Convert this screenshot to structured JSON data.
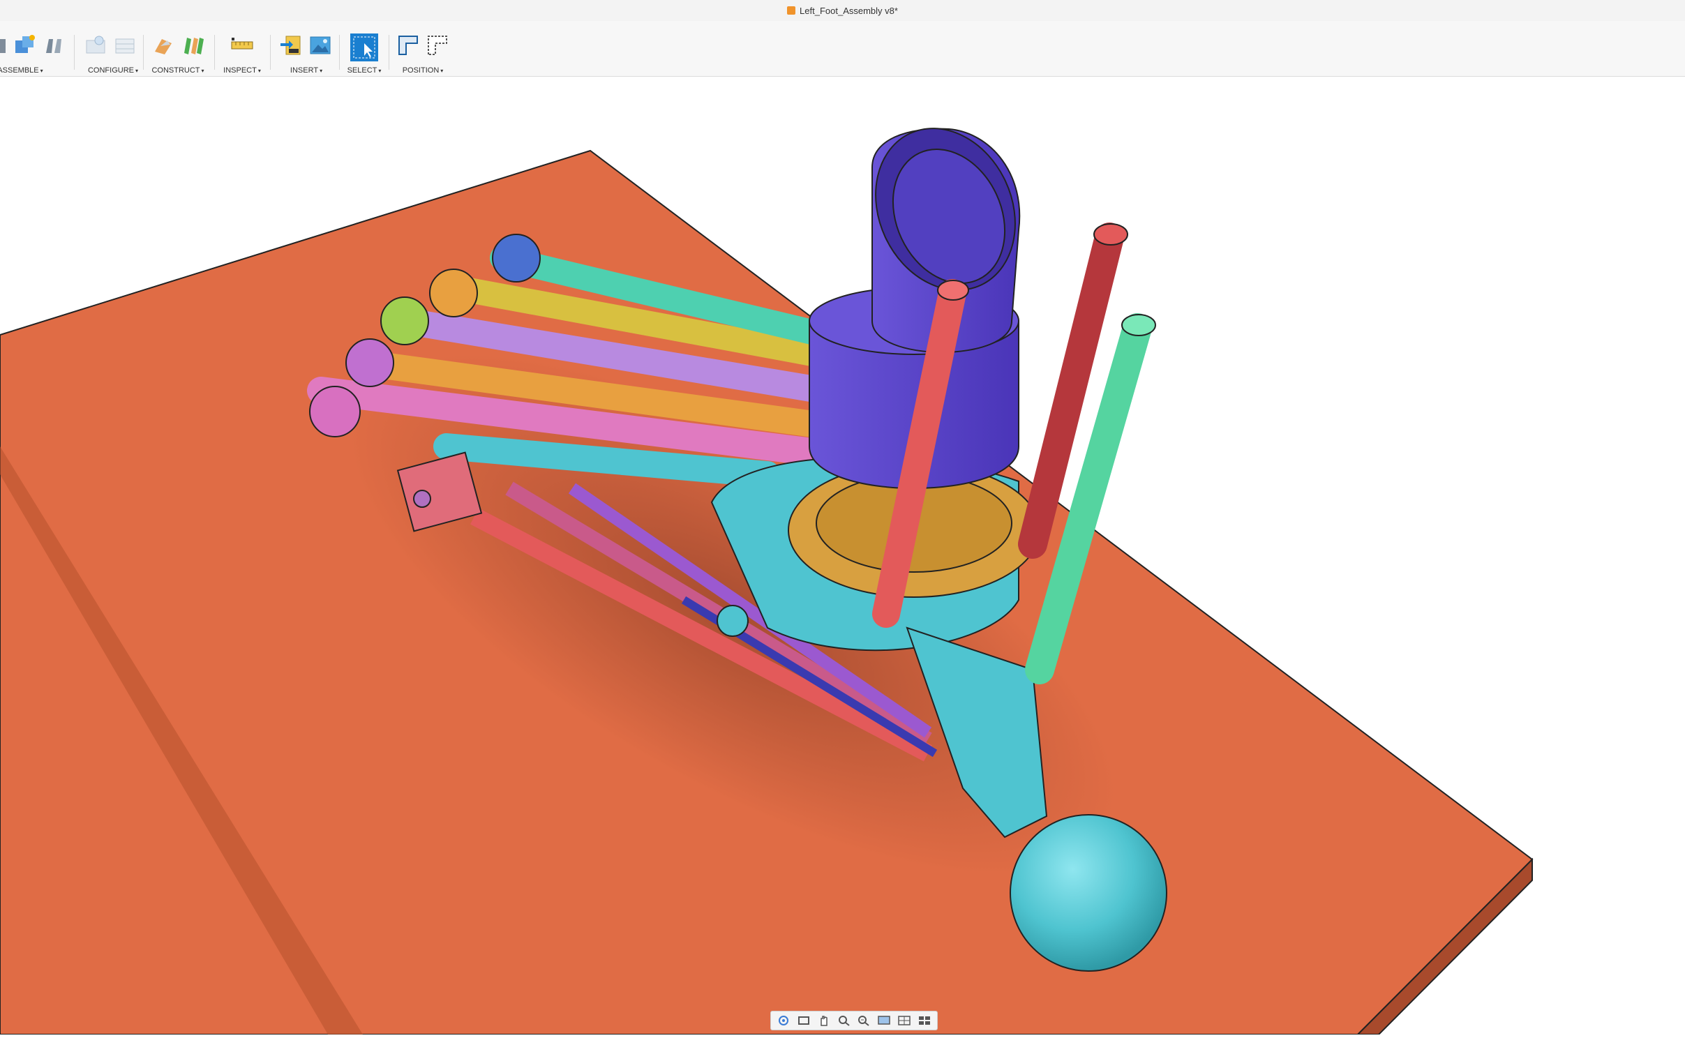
{
  "document": {
    "title": "Left_Foot_Assembly v8*"
  },
  "toolbar": {
    "groups": [
      {
        "label": "ASSEMBLE"
      },
      {
        "label": "CONFIGURE"
      },
      {
        "label": "CONSTRUCT"
      },
      {
        "label": "INSPECT"
      },
      {
        "label": "INSERT"
      },
      {
        "label": "SELECT"
      },
      {
        "label": "POSITION"
      }
    ],
    "caret": "▾"
  },
  "colors": {
    "plate": "#e06c45",
    "cyan_part": "#4fc4d0",
    "purple_cylinder": "#5b45c9",
    "red_rod": "#e35a5a",
    "dark_red_rod": "#b5373c",
    "green_rod": "#55d4a0",
    "select_blue": "#1a7fd0"
  },
  "nav_bar": {
    "icons": [
      "orbit-icon",
      "look-at-icon",
      "pan-icon",
      "zoom-fit-icon",
      "zoom-icon",
      "display-settings-icon",
      "grid-settings-icon",
      "viewports-icon"
    ]
  }
}
